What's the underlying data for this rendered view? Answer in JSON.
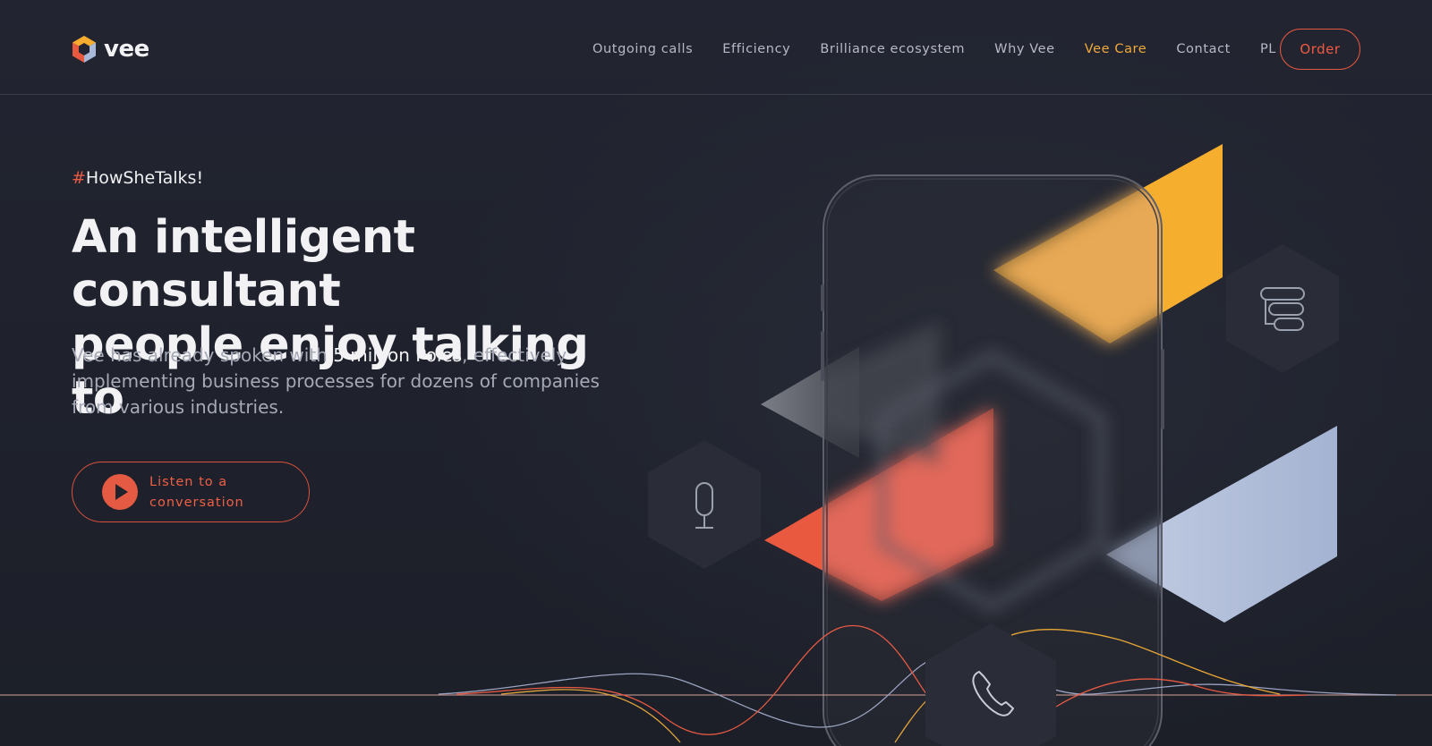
{
  "brand": {
    "name": "vee"
  },
  "nav": {
    "items": [
      {
        "label": "Outgoing calls"
      },
      {
        "label": "Efficiency"
      },
      {
        "label": "Brilliance ecosystem"
      },
      {
        "label": "Why Vee"
      },
      {
        "label": "Vee Care",
        "active": true
      },
      {
        "label": "Contact"
      },
      {
        "label": "PL"
      }
    ],
    "order_label": "Order"
  },
  "hero": {
    "hashtag_symbol": "#",
    "hashtag_text": "HowSheTalks!",
    "title_line1": "An intelligent consultant",
    "title_line2": "people enjoy talking to",
    "desc_before": "Vee has already spoken with ",
    "desc_highlight": "5 million Poles",
    "desc_after": ", effectively implementing business processes for dozens of companies from various industries.",
    "listen_label": "Listen to a conversation"
  },
  "icons": {
    "logo": "vee-hexagon-logo-icon",
    "play": "play-icon",
    "microphone": "microphone-icon",
    "list": "stacked-list-icon",
    "phone": "phone-handset-icon"
  },
  "colors": {
    "background": "#1e212b",
    "accent_red": "#e85a42",
    "accent_orange": "#f6ad2f",
    "accent_blue": "#a8b8d8",
    "active_nav": "#f0a93a"
  }
}
